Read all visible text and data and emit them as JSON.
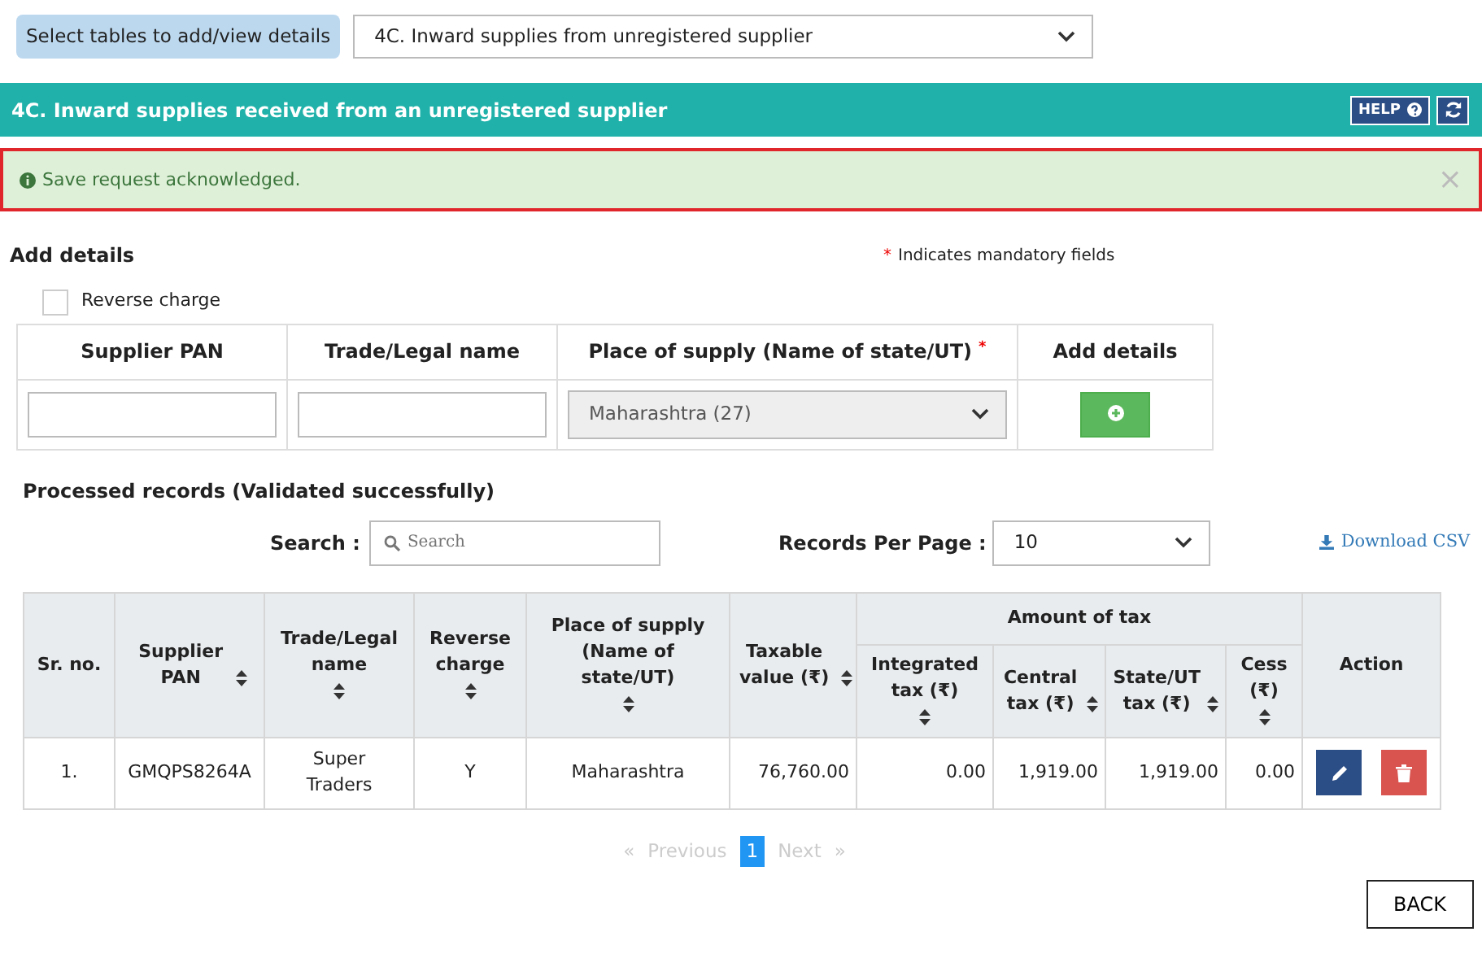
{
  "table_selector": {
    "label": "Select tables to add/view details",
    "value": "4C. Inward supplies from unregistered supplier"
  },
  "section": {
    "title": "4C. Inward supplies received from an unregistered supplier",
    "help": "HELP"
  },
  "alert": {
    "message": "Save request acknowledged.",
    "close": "×"
  },
  "add_details": {
    "title": "Add details",
    "mandatory_mark": "*",
    "mandatory_note": "Indicates mandatory fields",
    "reverse_charge": {
      "label": "Reverse charge",
      "checked": false
    },
    "columns": [
      {
        "label": "Supplier PAN",
        "required": false,
        "kind": "text"
      },
      {
        "label": "Trade/Legal name",
        "required": false,
        "kind": "text"
      },
      {
        "label": "Place of supply (Name of state/UT)",
        "required": true,
        "kind": "select",
        "value": "Maharashtra (27)"
      },
      {
        "label": "Add details",
        "required": false,
        "kind": "add"
      }
    ]
  },
  "processed": {
    "title": "Processed records (Validated successfully)",
    "search_label": "Search :",
    "search_placeholder": "Search",
    "records_label": "Records Per Page :",
    "records_value": "10",
    "download": "Download CSV"
  },
  "records_table": {
    "columns": [
      {
        "label": "Sr. no.",
        "sortable": false,
        "kind": "center"
      },
      {
        "label": "Supplier PAN",
        "sortable": true,
        "kind": "center"
      },
      {
        "label": "Trade/Legal name",
        "sortable": true,
        "kind": "center"
      },
      {
        "label": "Reverse charge",
        "sortable": true,
        "kind": "center"
      },
      {
        "label": "Place of supply (Name of state/UT)",
        "sortable": true,
        "kind": "center"
      },
      {
        "label": "Taxable value (₹)",
        "sortable": true,
        "kind": "amount"
      },
      {
        "label": "Amount of tax",
        "kind": "group",
        "colspan": 4,
        "children": [
          {
            "label": "Integrated tax (₹)",
            "sortable": true,
            "kind": "amount"
          },
          {
            "label": "Central tax (₹)",
            "sortable": true,
            "kind": "amount"
          },
          {
            "label": "State/UT tax (₹)",
            "sortable": true,
            "kind": "amount"
          },
          {
            "label": "Cess (₹)",
            "sortable": true,
            "kind": "amount"
          }
        ]
      },
      {
        "label": "Action",
        "sortable": false,
        "kind": "action"
      }
    ],
    "rows": [
      {
        "cells": [
          "1.",
          "GMQPS8264A",
          "Super Traders",
          "Y",
          "Maharashtra",
          "76,760.00",
          "0.00",
          "1,919.00",
          "1,919.00",
          "0.00"
        ],
        "actions": [
          {
            "kind": "edit"
          },
          {
            "kind": "delete"
          }
        ]
      }
    ]
  },
  "pagination": {
    "first_mark": "«",
    "previous": "Previous",
    "pages": [
      {
        "label": "1",
        "selected": true
      }
    ],
    "next": "Next",
    "last_mark": "»"
  },
  "back": "BACK"
}
